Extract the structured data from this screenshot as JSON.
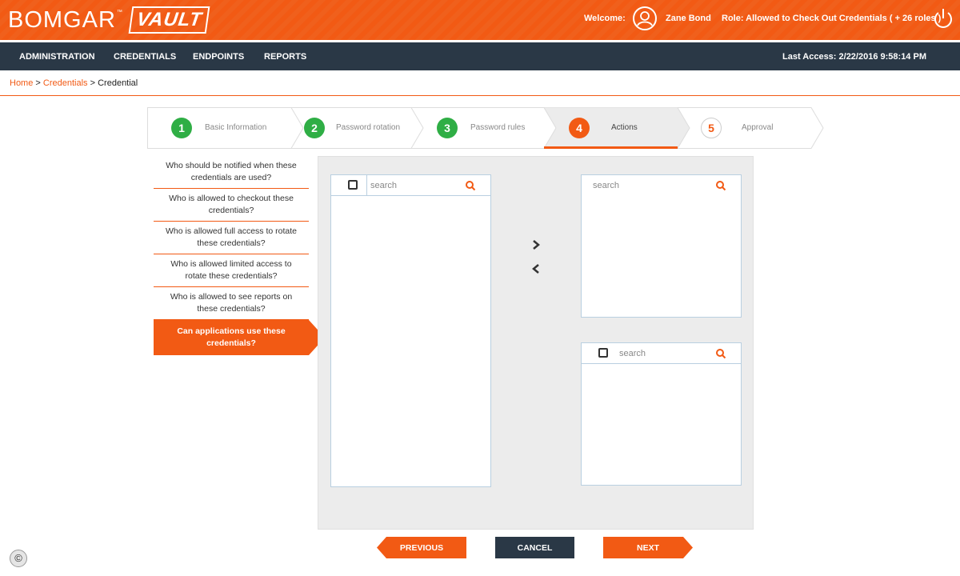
{
  "header": {
    "brand": "BOMGAR",
    "brand_tm": "™",
    "product": "VAULT",
    "welcome_label": "Welcome:",
    "user_name": "Zane Bond",
    "role_text": "Role: Allowed to Check Out Credentials ( + 26 roles )",
    "user_icon": "user-circle-icon",
    "power_icon": "power-icon"
  },
  "nav": {
    "items": [
      {
        "label": "ADMINISTRATION"
      },
      {
        "label": "CREDENTIALS"
      },
      {
        "label": "ENDPOINTS"
      },
      {
        "label": "REPORTS"
      }
    ],
    "last_access": "Last Access: 2/22/2016 9:58:14 PM"
  },
  "breadcrumb": {
    "home": "Home",
    "sep": ">",
    "credentials": "Credentials",
    "current": "Credential"
  },
  "steps": [
    {
      "num": "1",
      "label": "Basic Information",
      "state": "done"
    },
    {
      "num": "2",
      "label": "Password rotation",
      "state": "done"
    },
    {
      "num": "3",
      "label": "Password rules",
      "state": "done"
    },
    {
      "num": "4",
      "label": "Actions",
      "state": "active"
    },
    {
      "num": "5",
      "label": "Approval",
      "state": "todo"
    }
  ],
  "questions": [
    {
      "label": "Who should be notified when these credentials are used?"
    },
    {
      "label": "Who is allowed to checkout these credentials?"
    },
    {
      "label": "Who is allowed full access to rotate these credentials?"
    },
    {
      "label": "Who is allowed limited access to rotate these credentials?"
    },
    {
      "label": "Who is allowed to see reports on these credentials?"
    },
    {
      "label": "Can applications use these credentials?",
      "active": true
    }
  ],
  "panel": {
    "available_search_placeholder": "search",
    "selected_top_search_placeholder": "search",
    "selected_bottom_search_placeholder": "search",
    "move_right_icon": "chevron-right-icon",
    "move_left_icon": "chevron-left-icon",
    "search_icon": "search-icon"
  },
  "buttons": {
    "previous": "PREVIOUS",
    "cancel": "CANCEL",
    "next": "NEXT"
  },
  "footer": {
    "copyright_symbol": "©"
  },
  "colors": {
    "accent": "#f25a14",
    "nav_bg": "#2a3846",
    "success": "#2fae45"
  }
}
